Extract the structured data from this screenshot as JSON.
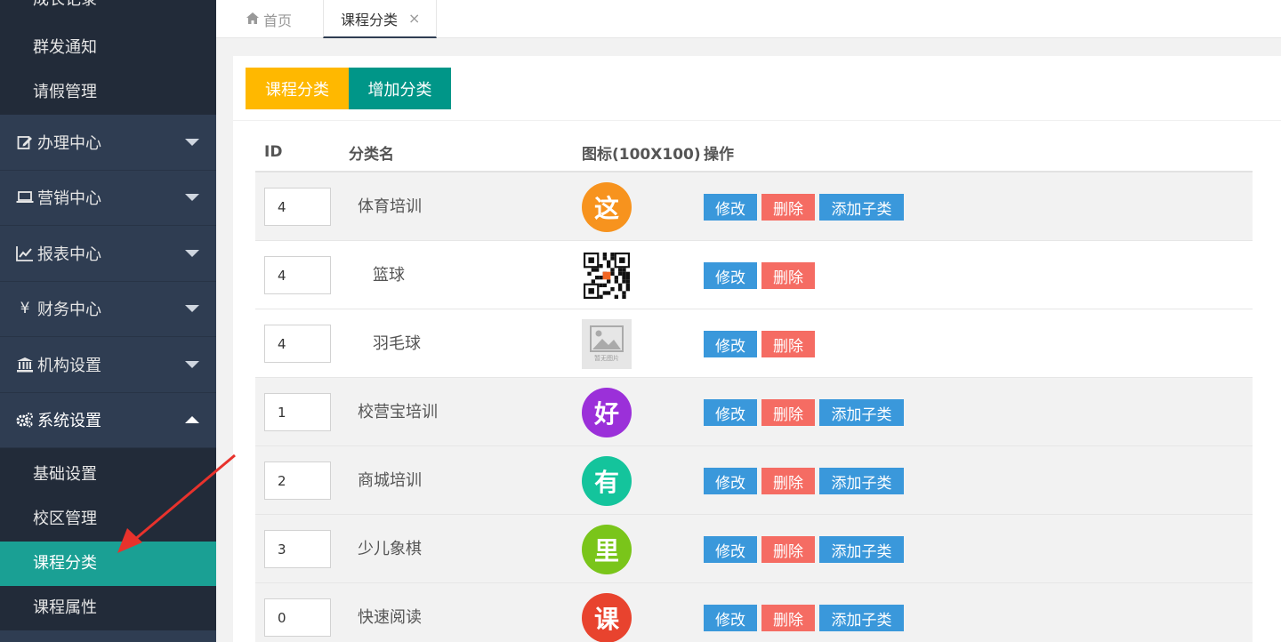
{
  "sidebar": {
    "top_items": [
      "成长记录",
      "群发通知",
      "请假管理"
    ],
    "menus": [
      {
        "label": "办理中心",
        "icon": "edit-icon",
        "expanded": false
      },
      {
        "label": "营销中心",
        "icon": "laptop-icon",
        "expanded": false
      },
      {
        "label": "报表中心",
        "icon": "chart-icon",
        "expanded": false
      },
      {
        "label": "财务中心",
        "icon": "yen-icon",
        "expanded": false
      },
      {
        "label": "机构设置",
        "icon": "bank-icon",
        "expanded": false
      },
      {
        "label": "系统设置",
        "icon": "gears-icon",
        "expanded": true
      }
    ],
    "sub_items": [
      "基础设置",
      "校区管理",
      "课程分类",
      "课程属性"
    ],
    "active_sub": "课程分类"
  },
  "tabs": {
    "home": "首页",
    "current": "课程分类"
  },
  "toolbar": {
    "category_label": "课程分类",
    "add_label": "增加分类"
  },
  "table": {
    "headers": {
      "id": "ID",
      "name": "分类名",
      "icon": "图标(100X100)",
      "ops": "操作"
    },
    "actions": {
      "edit": "修改",
      "delete": "删除",
      "add_child": "添加子类"
    },
    "rows": [
      {
        "id": "4",
        "name": "体育培训",
        "type": "parent",
        "icon": "circle",
        "glyph": "这",
        "color": "#f7931e"
      },
      {
        "id": "4",
        "name": "篮球",
        "type": "child",
        "icon": "qr"
      },
      {
        "id": "4",
        "name": "羽毛球",
        "type": "child",
        "icon": "placeholder",
        "placeholder_text": "暂无图片"
      },
      {
        "id": "1",
        "name": "校营宝培训",
        "type": "parent",
        "icon": "circle",
        "glyph": "好",
        "color": "#9b30d9"
      },
      {
        "id": "2",
        "name": "商城培训",
        "type": "parent",
        "icon": "circle",
        "glyph": "有",
        "color": "#14c49c"
      },
      {
        "id": "3",
        "name": "少儿象棋",
        "type": "parent",
        "icon": "circle",
        "glyph": "里",
        "color": "#7ac51a"
      },
      {
        "id": "0",
        "name": "快速阅读",
        "type": "parent",
        "icon": "circle",
        "glyph": "课",
        "color": "#e8432e"
      }
    ]
  },
  "colors": {
    "sidebar_bg": "#2f3d52",
    "submenu_bg": "#222b39",
    "active_bg": "#1aa094",
    "yellow_btn": "#ffb800",
    "teal_btn": "#009688",
    "blue_btn": "#3a98db",
    "red_btn": "#f56c63",
    "arrow": "#e8322c"
  }
}
